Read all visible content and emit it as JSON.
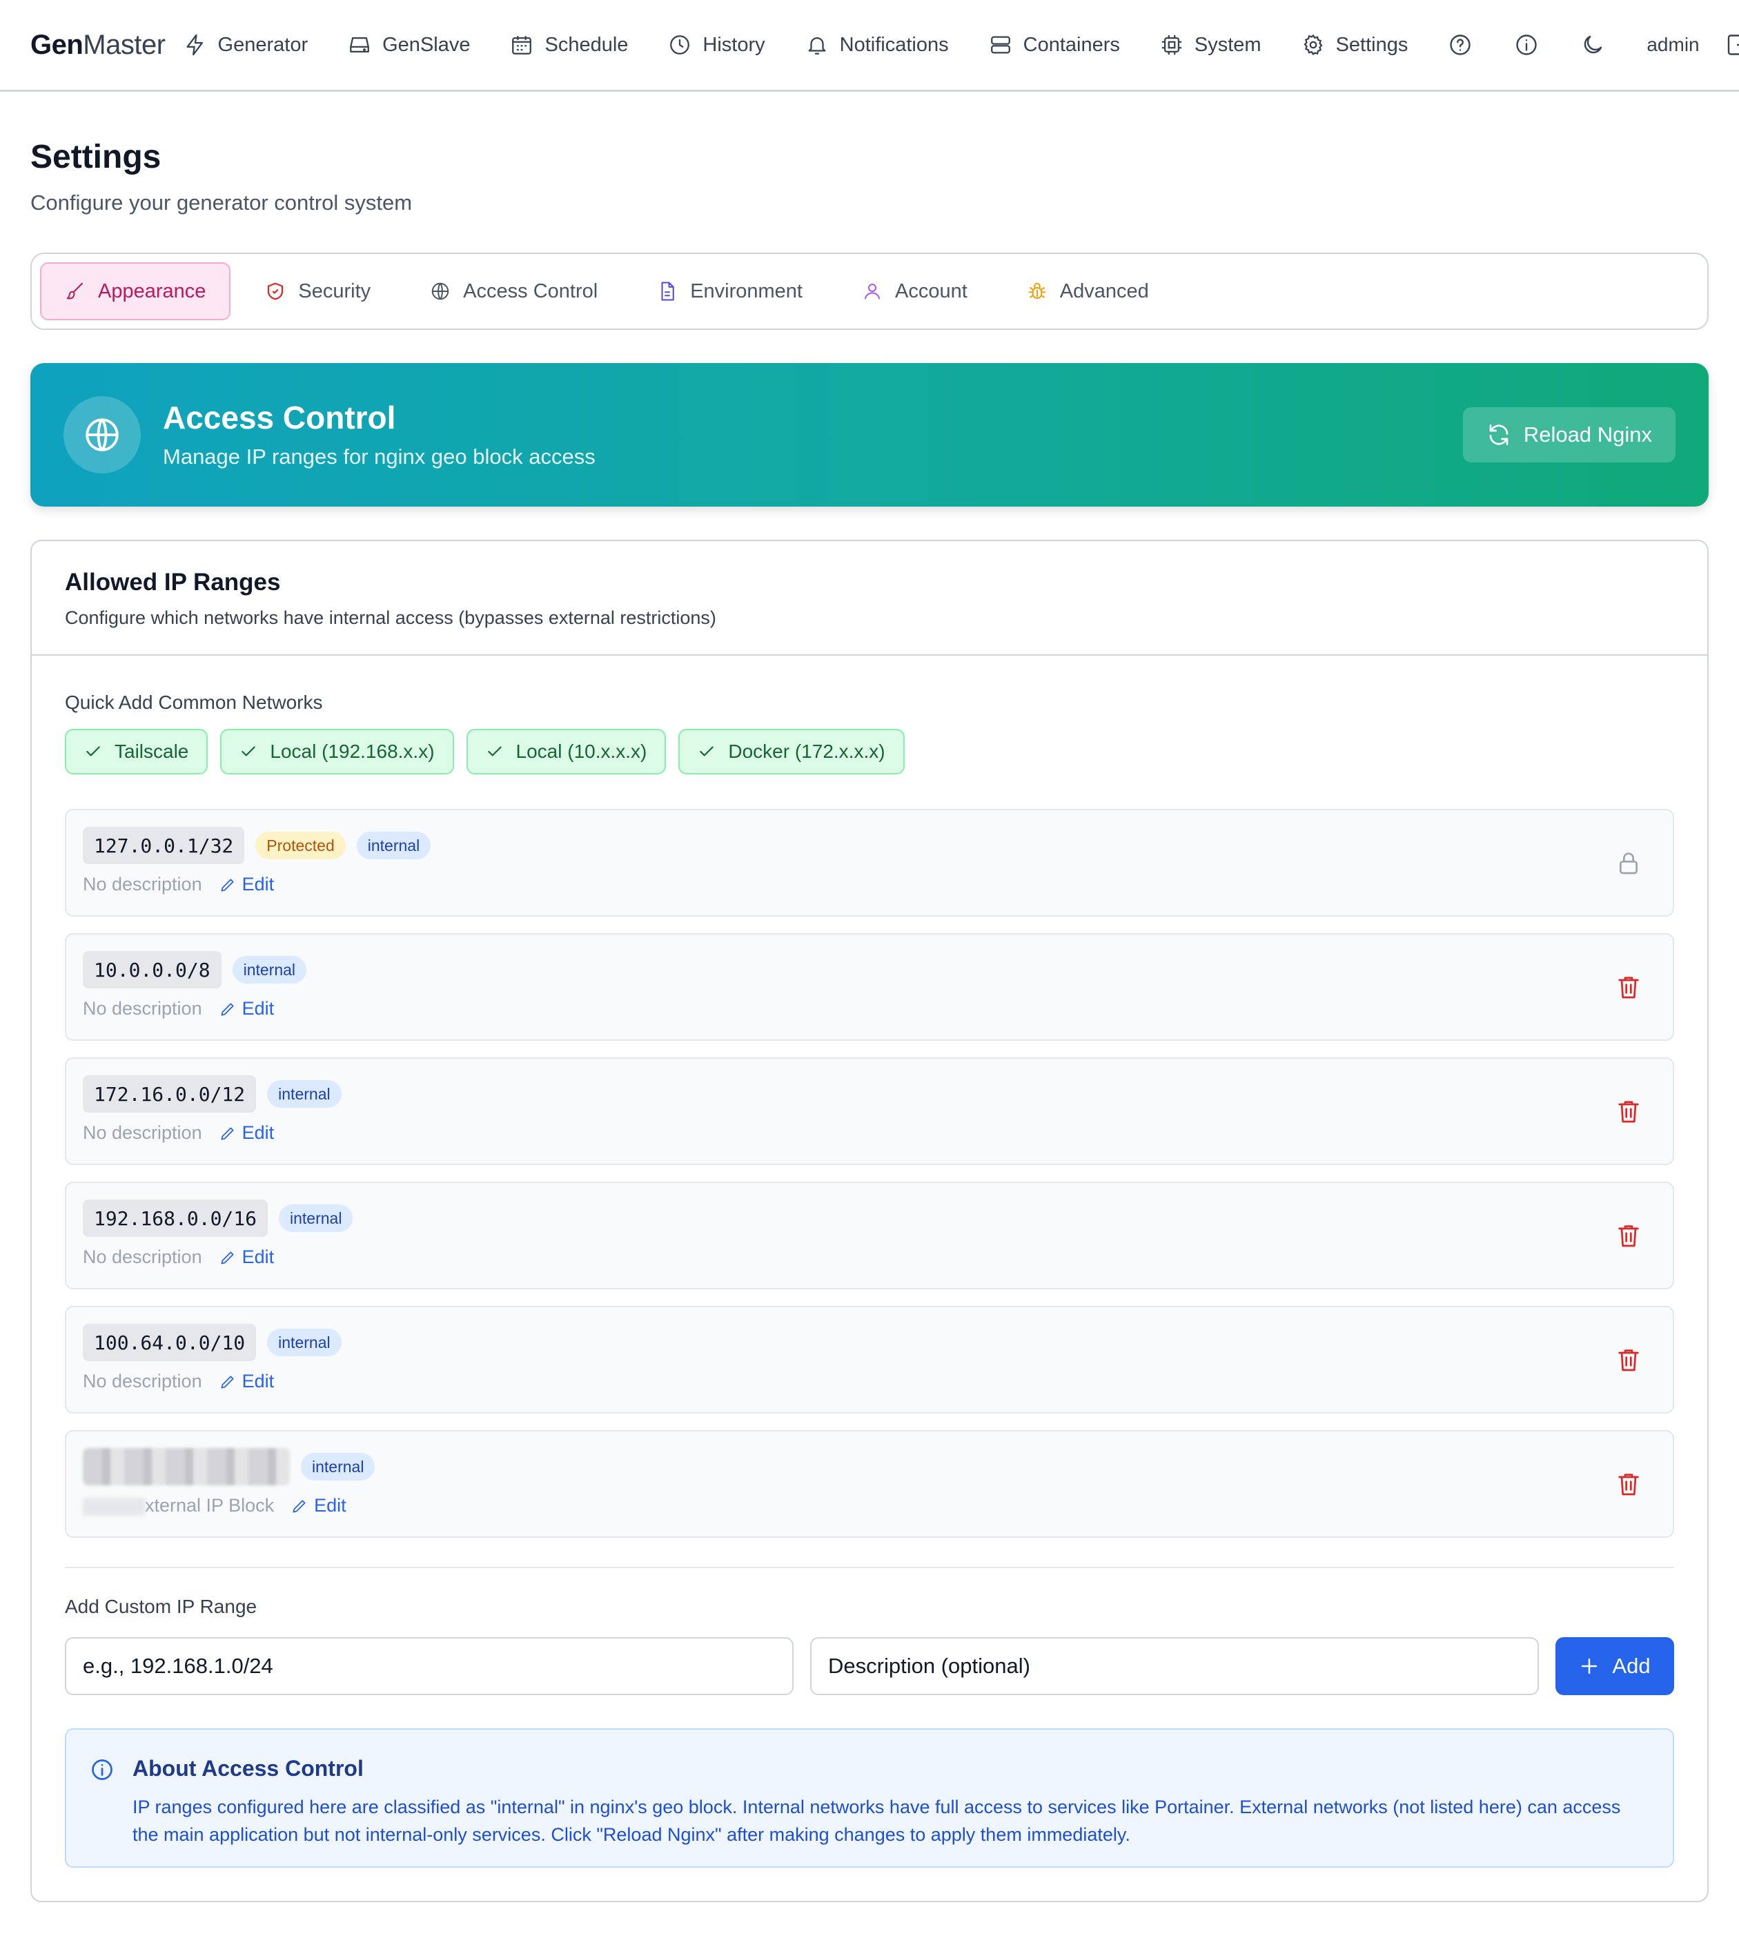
{
  "nav": {
    "brand_bold": "Gen",
    "brand_light": "Master",
    "items": [
      {
        "label": "Generator",
        "icon": "bolt-icon"
      },
      {
        "label": "GenSlave",
        "icon": "drive-icon"
      },
      {
        "label": "Schedule",
        "icon": "calendar-icon"
      },
      {
        "label": "History",
        "icon": "clock-icon"
      },
      {
        "label": "Notifications",
        "icon": "bell-icon"
      },
      {
        "label": "Containers",
        "icon": "server-icon"
      },
      {
        "label": "System",
        "icon": "cpu-icon"
      },
      {
        "label": "Settings",
        "icon": "gear-icon"
      }
    ],
    "user": "admin"
  },
  "page": {
    "title": "Settings",
    "subtitle": "Configure your generator control system"
  },
  "tabs": [
    {
      "label": "Appearance",
      "icon": "brush-icon",
      "active": true
    },
    {
      "label": "Security",
      "icon": "shield-icon",
      "active": false
    },
    {
      "label": "Access Control",
      "icon": "globe-icon",
      "active": false
    },
    {
      "label": "Environment",
      "icon": "file-icon",
      "active": false
    },
    {
      "label": "Account",
      "icon": "user-icon",
      "active": false
    },
    {
      "label": "Advanced",
      "icon": "bug-icon",
      "active": false
    }
  ],
  "hero": {
    "title": "Access Control",
    "subtitle": "Manage IP ranges for nginx geo block access",
    "reload_label": "Reload Nginx"
  },
  "card": {
    "title": "Allowed IP Ranges",
    "subtitle": "Configure which networks have internal access (bypasses external restrictions)",
    "quick_add_label": "Quick Add Common Networks",
    "quick_add": [
      "Tailscale",
      "Local (192.168.x.x)",
      "Local (10.x.x.x)",
      "Docker (172.x.x.x)"
    ],
    "edit_label": "Edit",
    "protected_label": "Protected",
    "ranges": [
      {
        "cidr": "127.0.0.1/32",
        "protected": true,
        "type": "internal",
        "description": "No description"
      },
      {
        "cidr": "10.0.0.0/8",
        "protected": false,
        "type": "internal",
        "description": "No description"
      },
      {
        "cidr": "172.16.0.0/12",
        "protected": false,
        "type": "internal",
        "description": "No description"
      },
      {
        "cidr": "192.168.0.0/16",
        "protected": false,
        "type": "internal",
        "description": "No description"
      },
      {
        "cidr": "100.64.0.0/10",
        "protected": false,
        "type": "internal",
        "description": "No description"
      },
      {
        "cidr": "",
        "protected": false,
        "type": "internal",
        "description": "xternal IP Block"
      }
    ],
    "custom_label": "Add Custom IP Range",
    "ip_placeholder": "e.g., 192.168.1.0/24",
    "desc_placeholder": "Description (optional)",
    "add_label": "Add"
  },
  "about": {
    "title": "About Access Control",
    "body": "IP ranges configured here are classified as \"internal\" in nginx's geo block. Internal networks have full access to services like Portainer. External networks (not listed here) can access the main application but not internal-only services. Click \"Reload Nginx\" after making changes to apply them immediately."
  },
  "colors": {
    "accent": "#2563eb",
    "hero_start": "#0fa2bf",
    "hero_end": "#10a97a",
    "active_tab": "#be185d",
    "danger": "#dc2626",
    "chip_green": "#166534"
  }
}
